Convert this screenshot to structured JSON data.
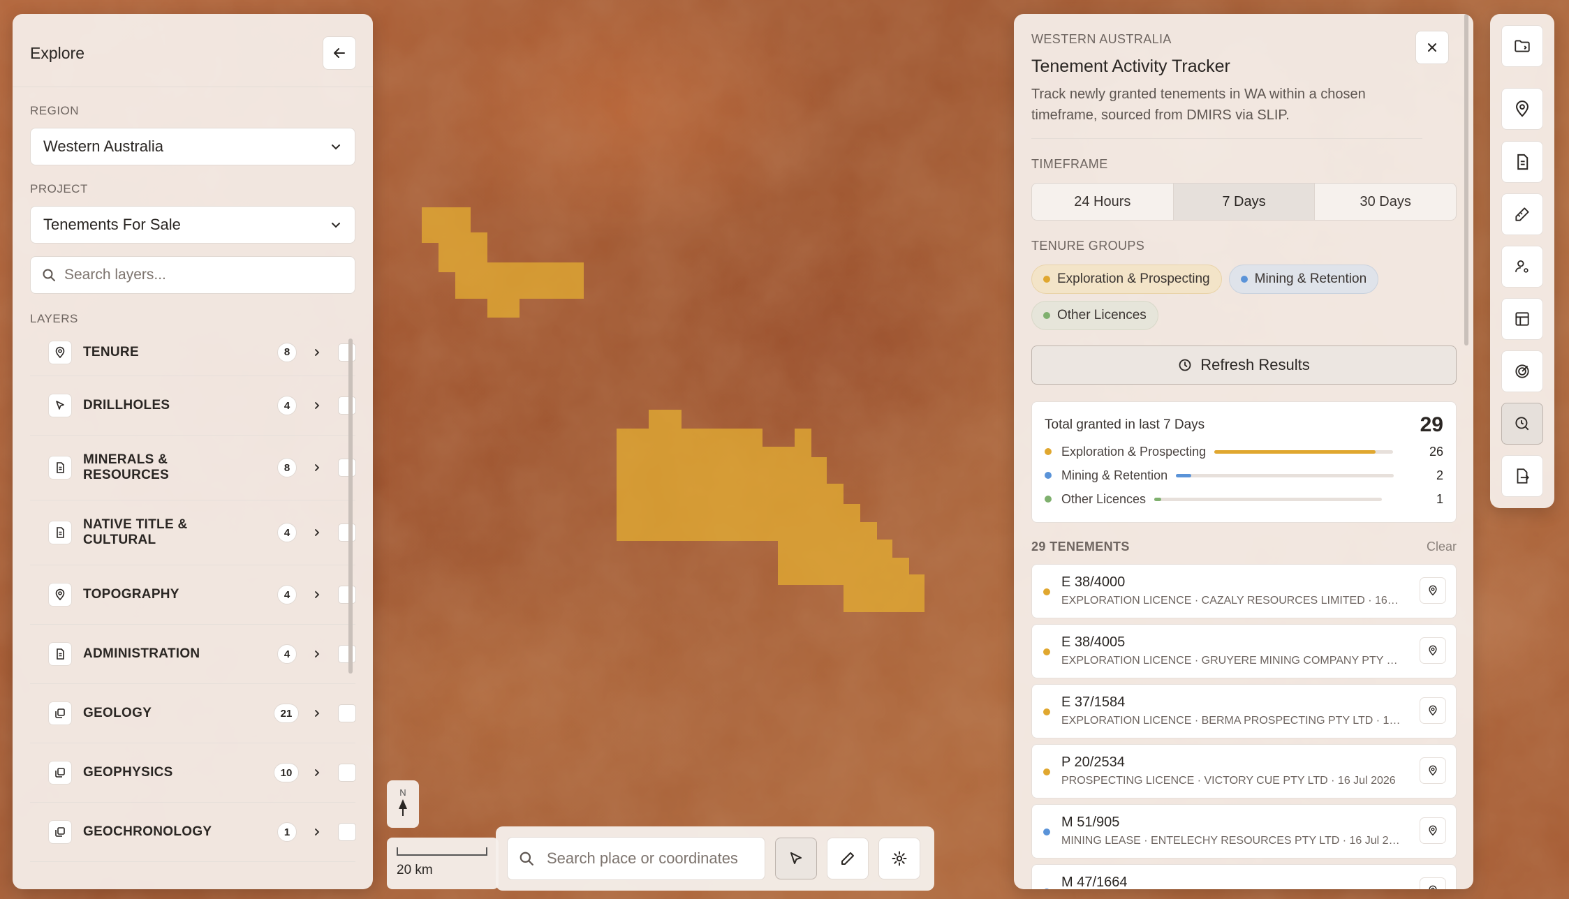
{
  "colors": {
    "exploration": "#e0a72f",
    "mining": "#5a93d8",
    "other": "#7fb06e",
    "tenement_fill": "rgba(230,176,50,0.72)"
  },
  "explore_panel": {
    "title": "Explore",
    "back_icon": "arrow-left-icon",
    "region_label": "REGION",
    "region_value": "Western Australia",
    "project_label": "PROJECT",
    "project_value": "Tenements For Sale",
    "search_placeholder": "Search layers...",
    "layers_label": "LAYERS",
    "layers": [
      {
        "name": "TENURE",
        "count": "8",
        "icon": "location-pin-icon"
      },
      {
        "name": "DRILLHOLES",
        "count": "4",
        "icon": "cursor-icon"
      },
      {
        "name": "MINERALS & RESOURCES",
        "count": "8",
        "icon": "document-icon"
      },
      {
        "name": "NATIVE TITLE & CULTURAL",
        "count": "4",
        "icon": "document-icon"
      },
      {
        "name": "TOPOGRAPHY",
        "count": "4",
        "icon": "location-pin-icon"
      },
      {
        "name": "ADMINISTRATION",
        "count": "4",
        "icon": "document-icon"
      },
      {
        "name": "GEOLOGY",
        "count": "21",
        "icon": "layers-stack-icon"
      },
      {
        "name": "GEOPHYSICS",
        "count": "10",
        "icon": "layers-stack-icon"
      },
      {
        "name": "GEOCHRONOLOGY",
        "count": "1",
        "icon": "layers-stack-icon"
      }
    ]
  },
  "map_controls": {
    "compass_label": "N",
    "scale_label": "20 km",
    "search_placeholder": "Search place or coordinates"
  },
  "tracker": {
    "eyebrow": "WESTERN AUSTRALIA",
    "title": "Tenement Activity Tracker",
    "description": "Track newly granted tenements in WA within a chosen timeframe, sourced from DMIRS via SLIP.",
    "timeframe_label": "TIMEFRAME",
    "timeframes": [
      "24 Hours",
      "7 Days",
      "30 Days"
    ],
    "timeframe_selected": "7 Days",
    "tenure_groups_label": "TENURE GROUPS",
    "tenure_groups": [
      "Exploration & Prospecting",
      "Mining & Retention",
      "Other Licences"
    ],
    "refresh_label": "Refresh Results",
    "summary": {
      "label": "Total granted in last 7 Days",
      "total": "29",
      "rows": [
        {
          "name": "Exploration & Prospecting",
          "value": "26",
          "fraction": 0.9
        },
        {
          "name": "Mining & Retention",
          "value": "2",
          "fraction": 0.07
        },
        {
          "name": "Other Licences",
          "value": "1",
          "fraction": 0.03
        }
      ]
    },
    "list_label": "29 TENEMENTS",
    "clear_label": "Clear",
    "tenements": [
      {
        "id": "E 38/4000",
        "detail": "EXPLORATION LICENCE · CAZALY RESOURCES LIMITED · 16 J...",
        "group": "exploration"
      },
      {
        "id": "E 38/4005",
        "detail": "EXPLORATION LICENCE · GRUYERE MINING COMPANY PTY L...",
        "group": "exploration"
      },
      {
        "id": "E 37/1584",
        "detail": "EXPLORATION LICENCE · BERMA PROSPECTING PTY LTD · 16 ...",
        "group": "exploration"
      },
      {
        "id": "P 20/2534",
        "detail": "PROSPECTING LICENCE · VICTORY CUE PTY LTD · 16 Jul 2026",
        "group": "exploration"
      },
      {
        "id": "M 51/905",
        "detail": "MINING LEASE · ENTELECHY RESOURCES PTY LTD · 16 Jul 20...",
        "group": "mining"
      },
      {
        "id": "M 47/1664",
        "detail": "",
        "group": "mining"
      }
    ]
  },
  "rail": {
    "buttons": [
      "folder-icon",
      "location-pin-icon",
      "document-icon",
      "pen-ruler-icon",
      "user-settings-icon",
      "table-icon",
      "target-icon",
      "search-clock-icon",
      "file-export-icon"
    ],
    "active": "search-clock-icon"
  }
}
